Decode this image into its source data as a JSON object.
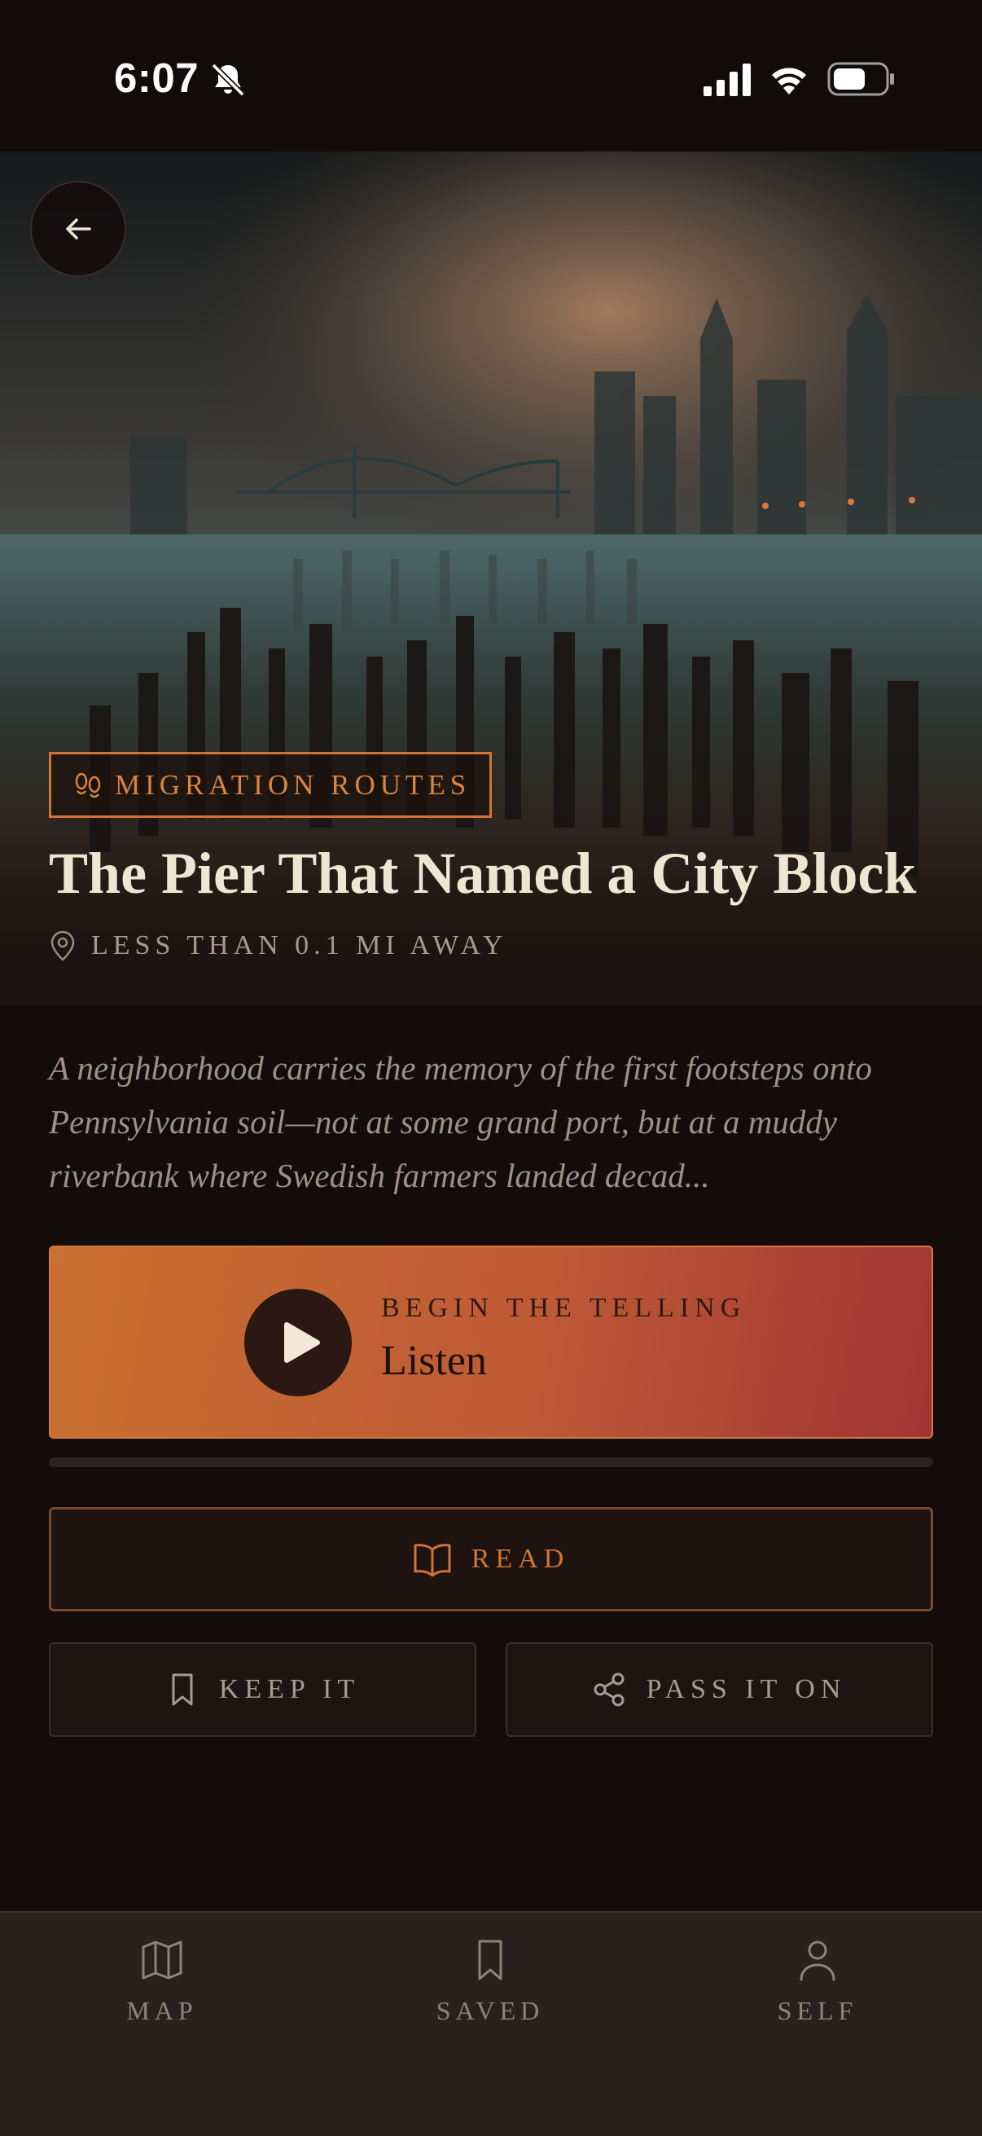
{
  "status_bar": {
    "time": "6:07"
  },
  "place": {
    "category": "MIGRATION ROUTES",
    "title": "The Pier That Named a City Block",
    "distance": "LESS THAN 0.1 MI AWAY",
    "description": "A neighborhood carries the memory of the first footsteps onto Pennsylvania soil—not at some grand port, but at a muddy riverbank where Swedish farmers landed decad..."
  },
  "listen": {
    "kicker": "BEGIN THE TELLING",
    "label": "Listen",
    "progress": 0
  },
  "actions": {
    "read": "READ",
    "keep": "KEEP IT",
    "pass": "PASS IT ON"
  },
  "nav": {
    "items": [
      {
        "label": "MAP",
        "icon": "map-icon"
      },
      {
        "label": "SAVED",
        "icon": "bookmark-icon"
      },
      {
        "label": "SELF",
        "icon": "person-icon"
      }
    ]
  },
  "colors": {
    "accent": "#cf7434",
    "background": "#130c0b",
    "listen_gradient_start": "#c96f30",
    "listen_gradient_end": "#a03434"
  }
}
